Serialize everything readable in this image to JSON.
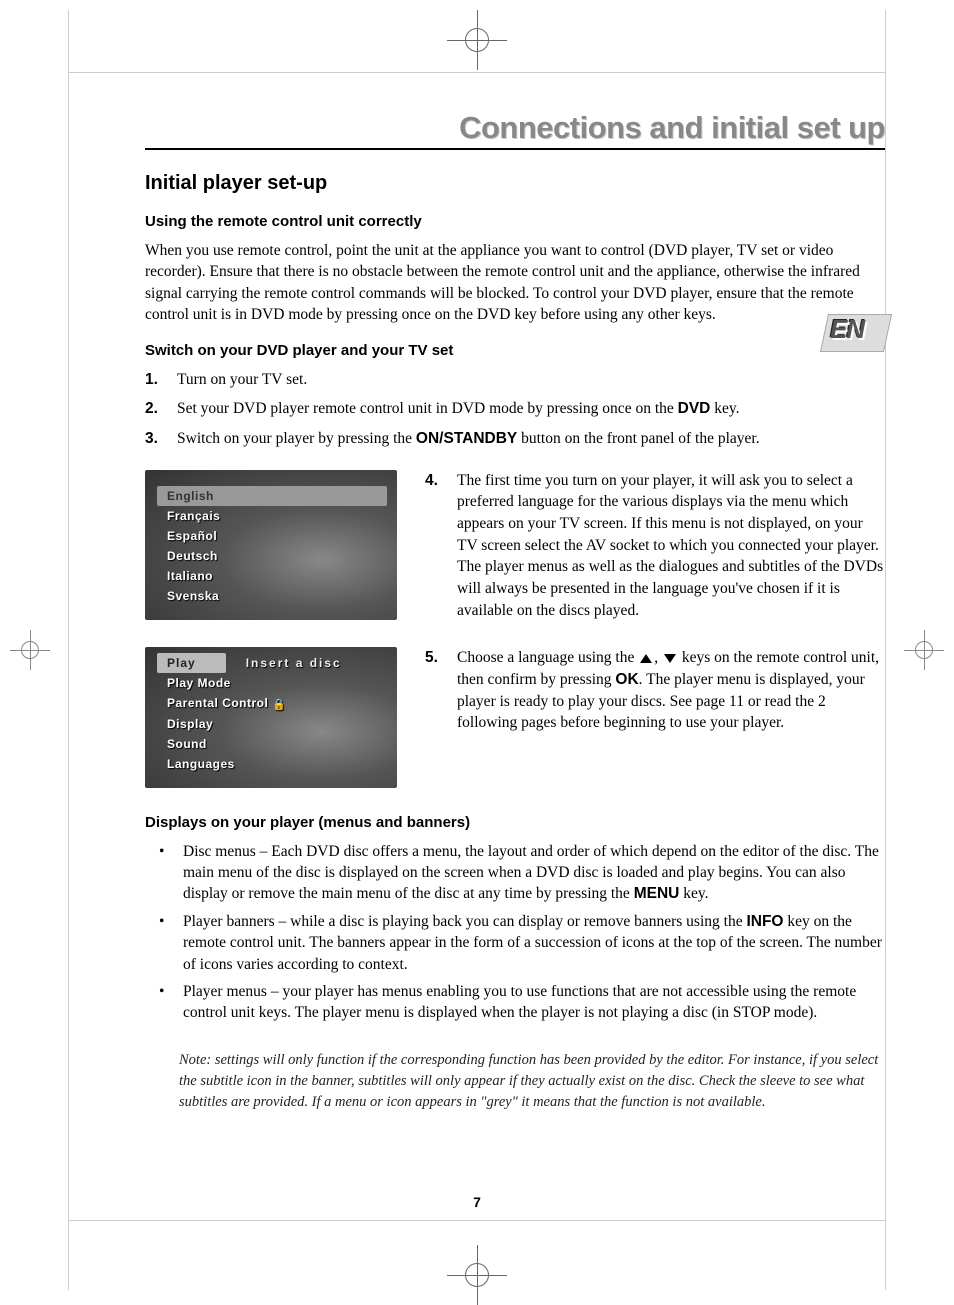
{
  "page_title": "Connections and initial set up",
  "section_heading": "Initial player set-up",
  "lang_tab": "EN",
  "sub_using_remote": "Using the remote control unit correctly",
  "p_remote": "When you use remote control, point the unit at the appliance you want to control (DVD player, TV set or video recorder). Ensure that there is no obstacle between the remote control unit and the appliance, otherwise the infrared signal carrying the remote control commands will be blocked. To control your DVD player, ensure that the remote control unit is in DVD mode by pressing once on the DVD key before using any other keys.",
  "sub_switch_on": "Switch on your DVD player and your TV set",
  "steps123": [
    {
      "num": "1.",
      "text": "Turn on your TV set."
    },
    {
      "num": "2.",
      "text_before": "Set your DVD player remote control unit in DVD mode by pressing once on the ",
      "bold": "DVD",
      "text_after": " key."
    },
    {
      "num": "3.",
      "text_before": "Switch on your player by pressing the ",
      "bold": "ON/STANDBY",
      "text_after": " button on the front panel of the player."
    }
  ],
  "screenshot1_items": [
    "English",
    "Français",
    "Español",
    "Deutsch",
    "Italiano",
    "Svenska"
  ],
  "step4": {
    "num": "4.",
    "text": "The first time you turn on your player, it will ask you to select a preferred language for the various displays via the menu which appears on your TV screen. If this menu is not displayed, on your TV screen select the AV socket to which you connected your player. The player menus as well as the dialogues and subtitles of the DVDs will always be presented in the language you've chosen if it is available on the discs played."
  },
  "screenshot2": {
    "play": "Play",
    "hint": "Insert a disc",
    "items": [
      "Play Mode",
      "Parental Control",
      "Display",
      "Sound",
      "Languages"
    ]
  },
  "step5": {
    "num": "5.",
    "pre": "Choose a language using the ",
    "mid": " keys on the remote control unit, then confirm by pressing ",
    "ok": "OK",
    "post": ". The player menu is displayed, your player is ready to play your discs. See page 11 or read the 2 following pages before beginning to use your player."
  },
  "sub_displays": "Displays on your player (menus and banners)",
  "bullets": [
    {
      "pre": "Disc menus – Each DVD disc offers a menu, the layout and order of which depend on the editor of the disc. The main menu of the disc is displayed on the screen when a DVD disc is loaded and play begins. You can also display or remove the main menu of the disc at any time by pressing the ",
      "bold": "MENU",
      "post": " key."
    },
    {
      "pre": "Player banners – while a disc is playing back you can display or remove banners using the ",
      "bold": "INFO",
      "post": " key on the remote control unit. The banners appear in the form of a succession of icons at the top of the screen. The number of icons varies according to context."
    },
    {
      "pre": "Player menus – your player has menus enabling you to use functions that are not accessible using the remote control unit keys. The player menu is displayed when the player is not playing a disc (in STOP mode).",
      "bold": "",
      "post": ""
    }
  ],
  "note": "Note: settings will only function if the corresponding function has been provided by the editor. For instance, if you select the subtitle icon in the banner, subtitles will only appear if they actually exist on the disc. Check the sleeve to see what subtitles are provided. If a menu or icon appears in \"grey\" it means that the function is not available.",
  "page_number": "7"
}
